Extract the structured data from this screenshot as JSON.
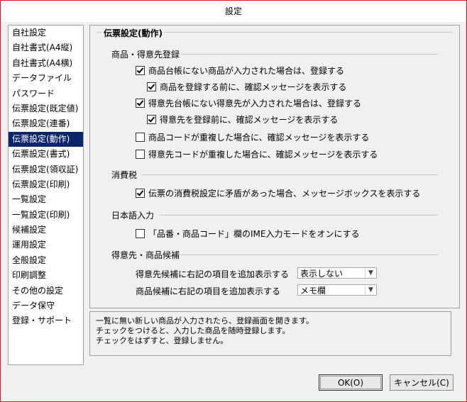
{
  "window": {
    "title": "設定"
  },
  "sidebar": {
    "selected_index": 7,
    "items": [
      "自社設定",
      "自社書式(A4縦)",
      "自社書式(A4横)",
      "データファイル",
      "パスワード",
      "伝票設定(既定値)",
      "伝票設定(連番)",
      "伝票設定(動作)",
      "伝票設定(書式)",
      "伝票設定(領収証)",
      "伝票設定(印刷)",
      "一覧設定",
      "一覧設定(印刷)",
      "候補設定",
      "運用設定",
      "全般設定",
      "印刷調整",
      "その他の設定",
      "データ保守",
      "登録・サポート"
    ]
  },
  "panel": {
    "title": "伝票設定(動作)",
    "sections": {
      "product_customer": "商品・得意先登録",
      "tax": "消費税",
      "ime": "日本語入力",
      "candidates": "得意先・商品候補"
    },
    "options": {
      "opt1": {
        "label": "商品台帳にない商品が入力された場合は、登録する",
        "checked": true
      },
      "opt2": {
        "label": "商品を登録する前に、確認メッセージを表示する",
        "checked": true
      },
      "opt3": {
        "label": "得意先台帳にない得意先が入力された場合は、登録する",
        "checked": true
      },
      "opt4": {
        "label": "得意先を登録前に、確認メッセージを表示する",
        "checked": true
      },
      "opt5": {
        "label": "商品コードが重複した場合に、確認メッセージを表示する",
        "checked": false
      },
      "opt6": {
        "label": "得意先コードが重複した場合に、確認メッセージを表示する",
        "checked": false
      },
      "opt7": {
        "label": "伝票の消費税設定に矛盾があった場合、メッセージボックスを表示する",
        "checked": true
      },
      "opt8": {
        "label": "「品番・商品コード」欄のIME入力モードをオンにする",
        "checked": false
      }
    },
    "dropdowns": {
      "customer_candidate_label": "得意先候補に右記の項目を追加表示する",
      "customer_candidate_value": "表示しない",
      "product_candidate_label": "商品候補に右記の項目を追加表示する",
      "product_candidate_value": "メモ欄"
    }
  },
  "help": {
    "line1": "一覧に無い新しい商品が入力されたら、登録画面を開きます。",
    "line2": "チェックをつけると、入力した商品を随時登録します。",
    "line3": "チェックをはずすと、登録しません。"
  },
  "buttons": {
    "ok": "OK(O)",
    "cancel": "キャンセル(C)"
  }
}
